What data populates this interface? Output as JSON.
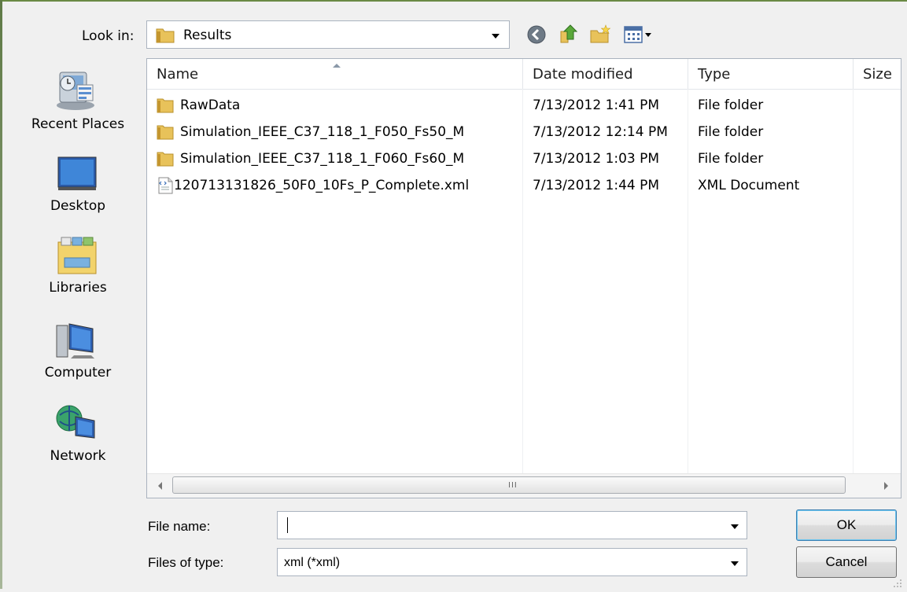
{
  "look_in": {
    "label": "Look in:",
    "value": "Results"
  },
  "toolbar": [
    "back-icon",
    "up-one-level-icon",
    "create-new-folder-icon",
    "view-menu-icon"
  ],
  "places": [
    {
      "label": "Recent Places",
      "icon": "recent-places-icon"
    },
    {
      "label": "Desktop",
      "icon": "desktop-icon"
    },
    {
      "label": "Libraries",
      "icon": "libraries-icon"
    },
    {
      "label": "Computer",
      "icon": "computer-icon"
    },
    {
      "label": "Network",
      "icon": "network-icon"
    }
  ],
  "columns": {
    "name": "Name",
    "date": "Date modified",
    "type": "Type",
    "size": "Size"
  },
  "files": [
    {
      "name": "RawData",
      "date": "7/13/2012 1:41 PM",
      "type": "File folder",
      "icon": "folder-icon"
    },
    {
      "name": "Simulation_IEEE_C37_118_1_F050_Fs50_M",
      "date": "7/13/2012 12:14 PM",
      "type": "File folder",
      "icon": "folder-icon"
    },
    {
      "name": "Simulation_IEEE_C37_118_1_F060_Fs60_M",
      "date": "7/13/2012 1:03 PM",
      "type": "File folder",
      "icon": "folder-icon"
    },
    {
      "name": "120713131826_50F0_10Fs_P_Complete.xml",
      "date": "7/13/2012 1:44 PM",
      "type": "XML Document",
      "icon": "xml-file-icon"
    }
  ],
  "scroll_grip": "III",
  "file_name": {
    "label": "File name:",
    "value": ""
  },
  "file_type": {
    "label": "Files of type:",
    "value": "xml (*xml)"
  },
  "buttons": {
    "ok": "OK",
    "cancel": "Cancel"
  },
  "colors": {
    "default_button_border": "#3c7fb1",
    "folder": "#e8c25a",
    "frame": "#6a8a44"
  }
}
